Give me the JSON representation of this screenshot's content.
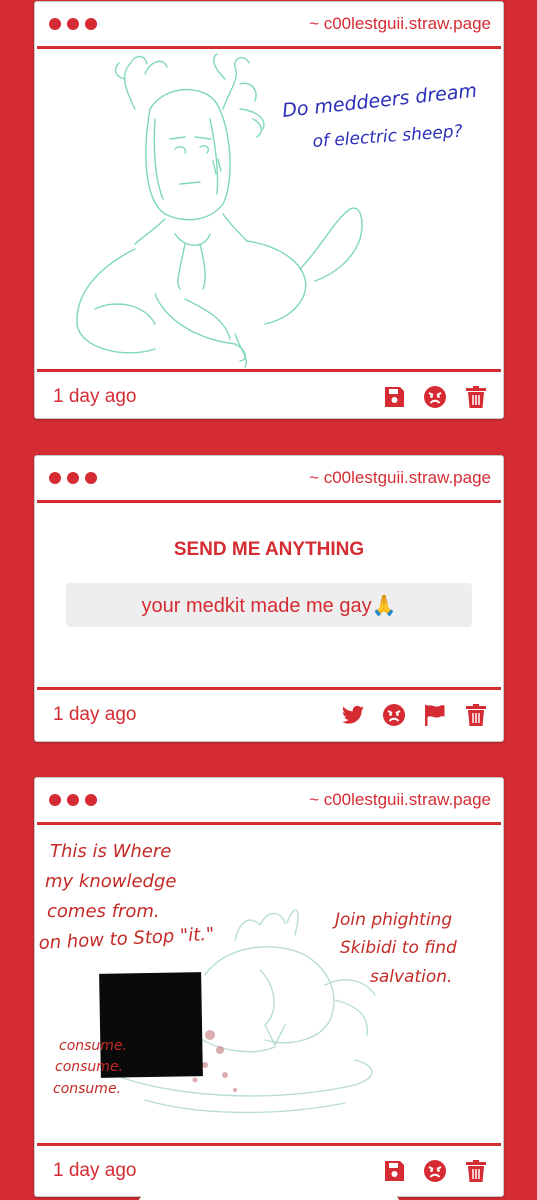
{
  "posts": [
    {
      "site": "~ c00lestguii.straw.page",
      "time": "1 day ago",
      "drawing": {
        "caption_line1": "Do meddeers dream",
        "caption_line2": "of electric sheep?"
      },
      "colors": {
        "sketch": "#7fd8b8",
        "caption": "#2b2fb8"
      }
    },
    {
      "site": "~ c00lestguii.straw.page",
      "time": "1 day ago",
      "title": "SEND ME ANYTHING",
      "message": "your medkit made me gay🙏"
    },
    {
      "site": "~ c00lestguii.straw.page",
      "time": "1 day ago",
      "drawing": {
        "left_lines": [
          "This is Where",
          "my knowledge",
          "comes from.",
          "on how to Stop \"it.\""
        ],
        "right_lines": [
          "Join phighting",
          "Skibidi to find",
          "salvation."
        ],
        "bottom_lines": [
          "consume.",
          "consume.",
          "consume."
        ]
      },
      "colors": {
        "text": "#c42a26",
        "sketch": "#b9ddd6"
      }
    }
  ],
  "colors": {
    "accent": "#d52c33",
    "background": "#d52c33",
    "card": "#ffffff",
    "message_box": "#eeeeee"
  },
  "icons": [
    "save-icon",
    "angry-face-icon",
    "trash-icon",
    "twitter-icon",
    "flag-icon"
  ]
}
